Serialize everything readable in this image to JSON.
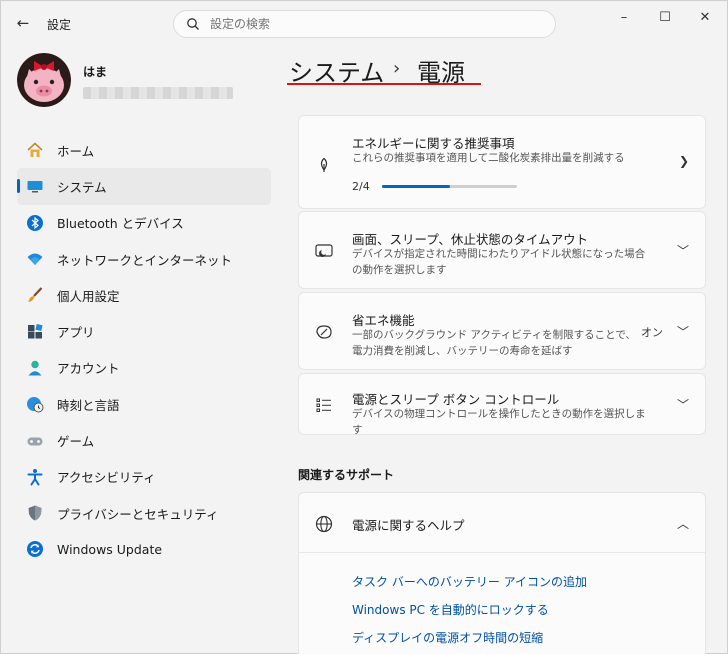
{
  "window": {
    "app_title": "設定",
    "minimize": "–",
    "maximize": "☐",
    "close": "✕"
  },
  "search": {
    "placeholder": "設定の検索"
  },
  "user": {
    "name": "はま"
  },
  "nav": [
    {
      "label": "ホーム",
      "icon": "home-icon"
    },
    {
      "label": "システム",
      "icon": "system-icon",
      "active": true
    },
    {
      "label": "Bluetooth とデバイス",
      "icon": "bluetooth-icon"
    },
    {
      "label": "ネットワークとインターネット",
      "icon": "wifi-icon"
    },
    {
      "label": "個人用設定",
      "icon": "brush-icon"
    },
    {
      "label": "アプリ",
      "icon": "apps-icon"
    },
    {
      "label": "アカウント",
      "icon": "account-icon"
    },
    {
      "label": "時刻と言語",
      "icon": "globe-clock-icon"
    },
    {
      "label": "ゲーム",
      "icon": "gamepad-icon"
    },
    {
      "label": "アクセシビリティ",
      "icon": "accessibility-icon"
    },
    {
      "label": "プライバシーとセキュリティ",
      "icon": "shield-icon"
    },
    {
      "label": "Windows Update",
      "icon": "update-icon"
    }
  ],
  "header": {
    "section": "システム",
    "separator": "›",
    "page": "電源"
  },
  "cards": {
    "energy": {
      "title": "エネルギーに関する推奨事項",
      "desc": "これらの推奨事項を適用して二酸化炭素排出量を削減する",
      "progress_label": "2/4",
      "progress": 0.5
    },
    "screen": {
      "title": "画面、スリープ、休止状態のタイムアウト",
      "desc": "デバイスが指定された時間にわたりアイドル状態になった場合の動作を選択します"
    },
    "saver": {
      "title": "省エネ機能",
      "desc": "一部のバックグラウンド アクティビティを制限することで、電力消費を削減し、バッテリーの寿命を延ばす",
      "status": "オン"
    },
    "buttons": {
      "title": "電源とスリープ ボタン コントロール",
      "desc": "デバイスの物理コントロールを操作したときの動作を選択します"
    }
  },
  "support": {
    "section_title": "関連するサポート",
    "help_title": "電源に関するヘルプ",
    "links": [
      "タスク バーへのバッテリー アイコンの追加",
      "Windows PC を自動的にロックする",
      "ディスプレイの電源オフ時間の短縮"
    ]
  },
  "colors": {
    "accent": "#0067c0",
    "link": "#0050a5",
    "underline": "#dd1111"
  }
}
